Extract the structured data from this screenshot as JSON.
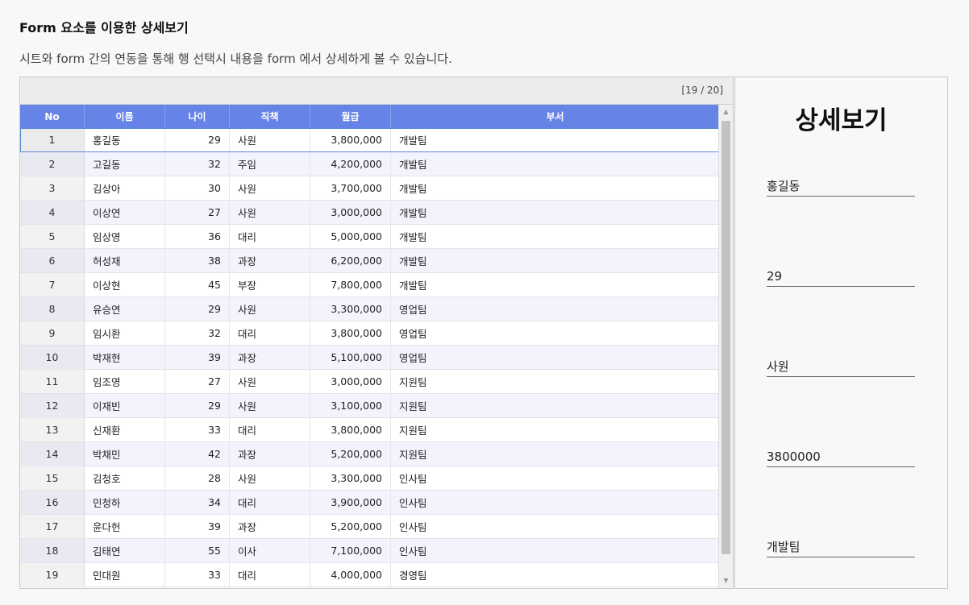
{
  "page": {
    "title": "Form 요소를 이용한 상세보기",
    "description": "시트와 form 간의 연동을 통해 행 선택시 내용을 form 에서 상세하게 볼 수 있습니다."
  },
  "sheet": {
    "counter": "[19 / 20]",
    "columns": [
      "No",
      "이름",
      "나이",
      "직책",
      "월급",
      "부서"
    ],
    "rows": [
      {
        "no": "1",
        "name": "홍길동",
        "age": "29",
        "position": "사원",
        "salary": "3,800,000",
        "dept": "개발팀"
      },
      {
        "no": "2",
        "name": "고길동",
        "age": "32",
        "position": "주임",
        "salary": "4,200,000",
        "dept": "개발팀"
      },
      {
        "no": "3",
        "name": "김상아",
        "age": "30",
        "position": "사원",
        "salary": "3,700,000",
        "dept": "개발팀"
      },
      {
        "no": "4",
        "name": "이상연",
        "age": "27",
        "position": "사원",
        "salary": "3,000,000",
        "dept": "개발팀"
      },
      {
        "no": "5",
        "name": "임상영",
        "age": "36",
        "position": "대리",
        "salary": "5,000,000",
        "dept": "개발팀"
      },
      {
        "no": "6",
        "name": "허성재",
        "age": "38",
        "position": "과장",
        "salary": "6,200,000",
        "dept": "개발팀"
      },
      {
        "no": "7",
        "name": "이상현",
        "age": "45",
        "position": "부장",
        "salary": "7,800,000",
        "dept": "개발팀"
      },
      {
        "no": "8",
        "name": "유승연",
        "age": "29",
        "position": "사원",
        "salary": "3,300,000",
        "dept": "영업팀"
      },
      {
        "no": "9",
        "name": "임시환",
        "age": "32",
        "position": "대리",
        "salary": "3,800,000",
        "dept": "영업팀"
      },
      {
        "no": "10",
        "name": "박재현",
        "age": "39",
        "position": "과장",
        "salary": "5,100,000",
        "dept": "영업팀"
      },
      {
        "no": "11",
        "name": "임조영",
        "age": "27",
        "position": "사원",
        "salary": "3,000,000",
        "dept": "지원팀"
      },
      {
        "no": "12",
        "name": "이재빈",
        "age": "29",
        "position": "사원",
        "salary": "3,100,000",
        "dept": "지원팀"
      },
      {
        "no": "13",
        "name": "신재환",
        "age": "33",
        "position": "대리",
        "salary": "3,800,000",
        "dept": "지원팀"
      },
      {
        "no": "14",
        "name": "박채민",
        "age": "42",
        "position": "과장",
        "salary": "5,200,000",
        "dept": "지원팀"
      },
      {
        "no": "15",
        "name": "김청호",
        "age": "28",
        "position": "사원",
        "salary": "3,300,000",
        "dept": "인사팀"
      },
      {
        "no": "16",
        "name": "민청하",
        "age": "34",
        "position": "대리",
        "salary": "3,900,000",
        "dept": "인사팀"
      },
      {
        "no": "17",
        "name": "윤다헌",
        "age": "39",
        "position": "과장",
        "salary": "5,200,000",
        "dept": "인사팀"
      },
      {
        "no": "18",
        "name": "김태연",
        "age": "55",
        "position": "이사",
        "salary": "7,100,000",
        "dept": "인사팀"
      },
      {
        "no": "19",
        "name": "민대원",
        "age": "33",
        "position": "대리",
        "salary": "4,000,000",
        "dept": "경영팀"
      }
    ],
    "selected_index": 0,
    "scroll_up_icon": "triangle-up-icon",
    "scroll_down_icon": "triangle-down-icon"
  },
  "detail": {
    "title": "상세보기",
    "fields": [
      "홍길동",
      "29",
      "사원",
      "3800000",
      "개발팀"
    ]
  },
  "colors": {
    "header_bg": "#6683e8",
    "alt_row_bg": "#f3f3fd",
    "selection_border": "#5b8bd8"
  }
}
